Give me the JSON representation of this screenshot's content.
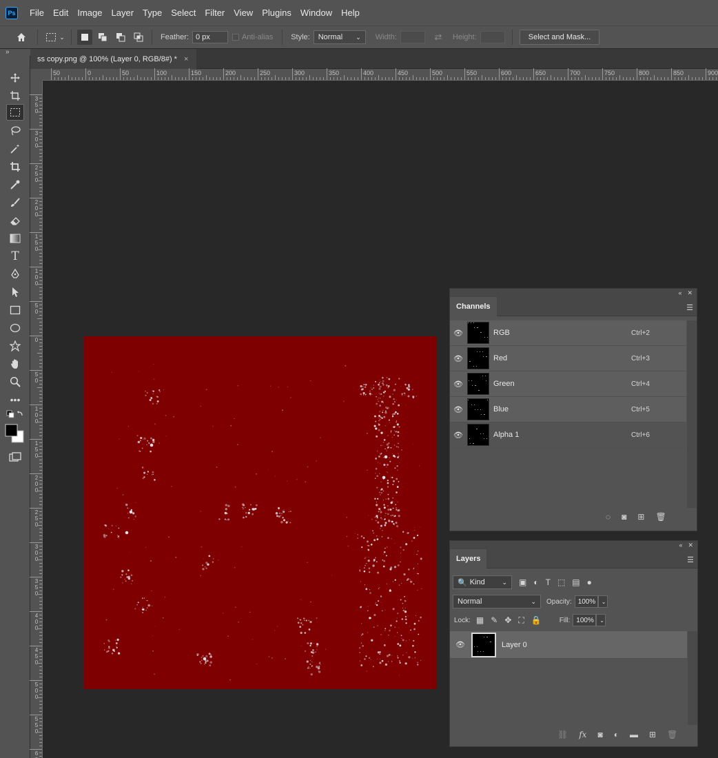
{
  "app": {
    "logo": "Ps"
  },
  "menu": [
    "File",
    "Edit",
    "Image",
    "Layer",
    "Type",
    "Select",
    "Filter",
    "View",
    "Plugins",
    "Window",
    "Help"
  ],
  "options": {
    "feather_label": "Feather:",
    "feather_value": "0 px",
    "antialias_label": "Anti-alias",
    "style_label": "Style:",
    "style_value": "Normal",
    "width_label": "Width:",
    "height_label": "Height:",
    "select_mask_label": "Select and Mask..."
  },
  "document": {
    "tab_title": "ss copy.png @ 100% (Layer 0, RGB/8#) *",
    "close": "×"
  },
  "ruler": {
    "h_labels": [
      "50",
      "0",
      "50",
      "100",
      "150",
      "200",
      "250",
      "300",
      "350",
      "400",
      "450",
      "500",
      "550",
      "600",
      "650",
      "700",
      "750",
      "800",
      "850",
      "900"
    ],
    "v_labels": [
      "350",
      "300",
      "250",
      "200",
      "150",
      "100",
      "50",
      "0",
      "50",
      "100",
      "150",
      "200",
      "250",
      "300",
      "350",
      "400",
      "450",
      "500",
      "550",
      "600"
    ]
  },
  "canvas": {
    "background": "#7e0000"
  },
  "channels": {
    "title": "Channels",
    "rows": [
      {
        "name": "RGB",
        "shortcut": "Ctrl+2"
      },
      {
        "name": "Red",
        "shortcut": "Ctrl+3"
      },
      {
        "name": "Green",
        "shortcut": "Ctrl+4"
      },
      {
        "name": "Blue",
        "shortcut": "Ctrl+5"
      },
      {
        "name": "Alpha 1",
        "shortcut": "Ctrl+6"
      }
    ]
  },
  "layers": {
    "title": "Layers",
    "filter_kind": "Kind",
    "blend_mode": "Normal",
    "opacity_label": "Opacity:",
    "opacity_value": "100%",
    "lock_label": "Lock:",
    "fill_label": "Fill:",
    "fill_value": "100%",
    "items": [
      {
        "name": "Layer 0"
      }
    ]
  },
  "colors": {
    "ui_bg": "#535353",
    "workspace": "#282828",
    "canvas_red": "#7e0000",
    "accent": "#31a8ff"
  }
}
